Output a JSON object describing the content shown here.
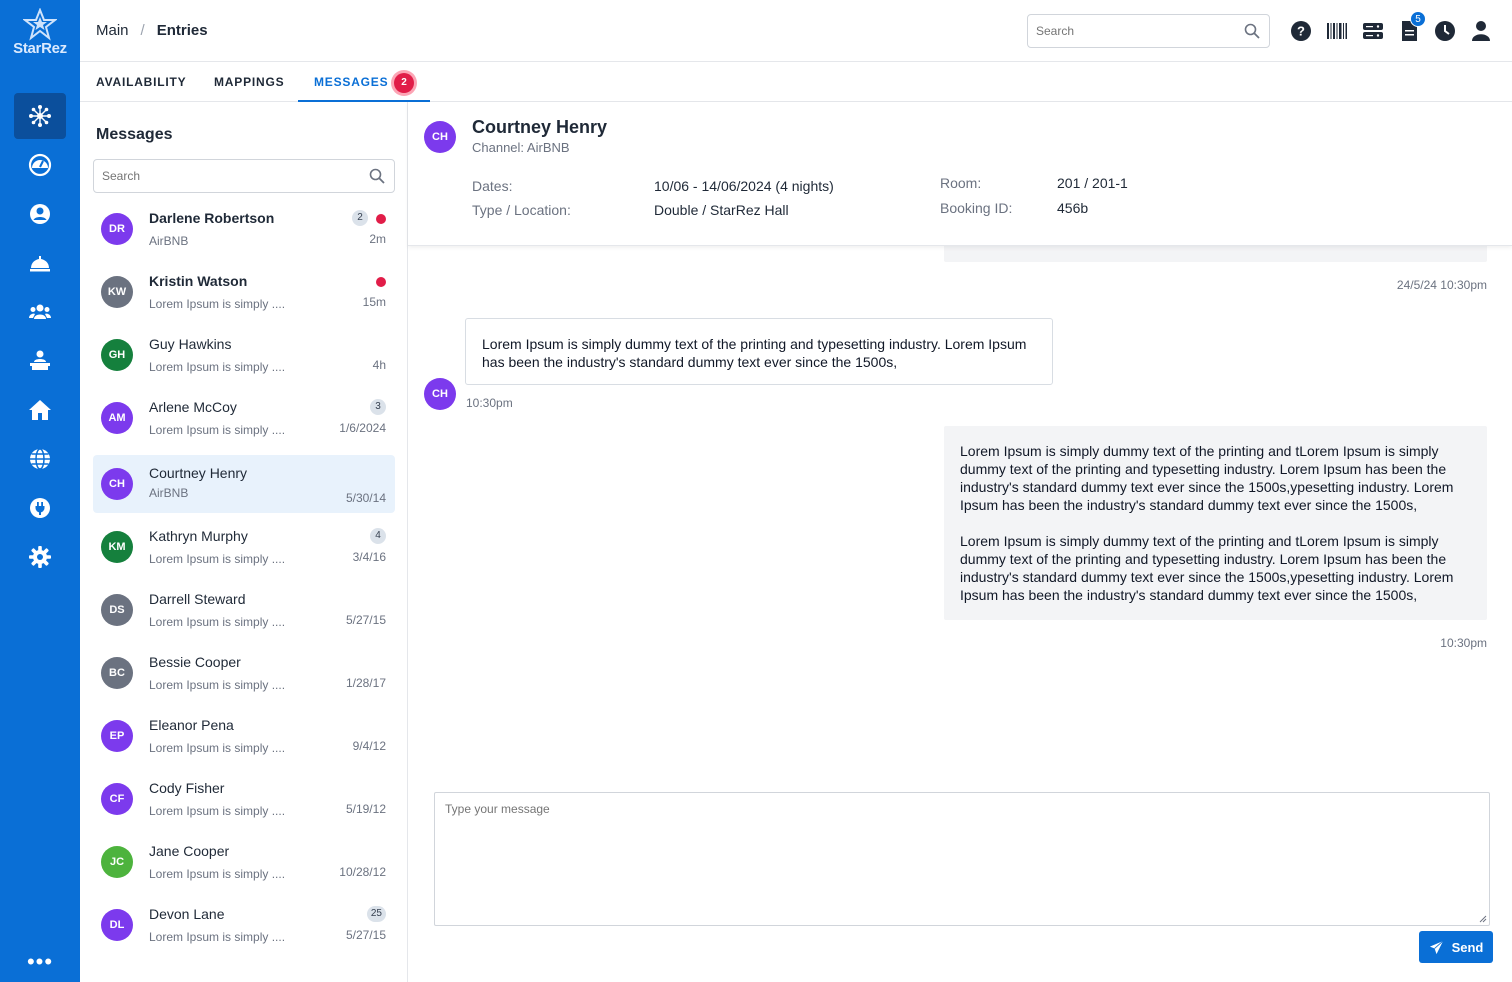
{
  "brand": {
    "logo_text": "StarRez"
  },
  "breadcrumb": {
    "root": "Main",
    "separator": "/",
    "current": "Entries"
  },
  "top_search": {
    "placeholder": "Search"
  },
  "top_icons": {
    "notifications_count": "5"
  },
  "tabs": [
    {
      "label": "AVAILABILITY"
    },
    {
      "label": "MAPPINGS"
    },
    {
      "label": "MESSAGES",
      "badge": "2"
    }
  ],
  "messages_panel": {
    "title": "Messages",
    "search_placeholder": "Search",
    "conversations": [
      {
        "initials": "DR",
        "name": "Darlene Robertson",
        "subtitle": "AirBNB",
        "time": "2m",
        "count": "2",
        "unread_dot": true,
        "bold": true,
        "avatar_color": "#7c3aed"
      },
      {
        "initials": "KW",
        "name": "Kristin Watson",
        "subtitle": "Lorem Ipsum is simply ....",
        "time": "15m",
        "count": "",
        "unread_dot": true,
        "bold": true,
        "avatar_color": "#6b7280"
      },
      {
        "initials": "GH",
        "name": "Guy Hawkins",
        "subtitle": "Lorem Ipsum is simply ....",
        "time": "4h",
        "count": "",
        "unread_dot": false,
        "bold": false,
        "avatar_color": "#15803d"
      },
      {
        "initials": "AM",
        "name": "Arlene McCoy",
        "subtitle": "Lorem Ipsum is simply ....",
        "time": "1/6/2024",
        "count": "3",
        "unread_dot": false,
        "bold": false,
        "avatar_color": "#7c3aed"
      },
      {
        "initials": "CH",
        "name": "Courtney Henry",
        "subtitle": "AirBNB",
        "time": "5/30/14",
        "count": "",
        "unread_dot": false,
        "bold": false,
        "avatar_color": "#7c3aed",
        "active": true
      },
      {
        "initials": "KM",
        "name": "Kathryn Murphy",
        "subtitle": "Lorem Ipsum is simply ....",
        "time": "3/4/16",
        "count": "4",
        "unread_dot": false,
        "bold": false,
        "avatar_color": "#15803d"
      },
      {
        "initials": "DS",
        "name": "Darrell Steward",
        "subtitle": "Lorem Ipsum is simply ....",
        "time": "5/27/15",
        "count": "",
        "unread_dot": false,
        "bold": false,
        "avatar_color": "#6b7280"
      },
      {
        "initials": "BC",
        "name": "Bessie Cooper",
        "subtitle": "Lorem Ipsum is simply ....",
        "time": "1/28/17",
        "count": "",
        "unread_dot": false,
        "bold": false,
        "avatar_color": "#6b7280"
      },
      {
        "initials": "EP",
        "name": "Eleanor Pena",
        "subtitle": "Lorem Ipsum is simply ....",
        "time": "9/4/12",
        "count": "",
        "unread_dot": false,
        "bold": false,
        "avatar_color": "#7c3aed"
      },
      {
        "initials": "CF",
        "name": "Cody Fisher",
        "subtitle": "Lorem Ipsum is simply ....",
        "time": "5/19/12",
        "count": "",
        "unread_dot": false,
        "bold": false,
        "avatar_color": "#7c3aed"
      },
      {
        "initials": "JC",
        "name": "Jane Cooper",
        "subtitle": "Lorem Ipsum is simply ....",
        "time": "10/28/12",
        "count": "",
        "unread_dot": false,
        "bold": false,
        "avatar_color": "#4db33d"
      },
      {
        "initials": "DL",
        "name": "Devon Lane",
        "subtitle": "Lorem Ipsum is simply ....",
        "time": "5/27/15",
        "count": "25",
        "unread_dot": false,
        "bold": false,
        "avatar_color": "#7c3aed"
      }
    ]
  },
  "chat_header": {
    "initials": "CH",
    "name": "Courtney Henry",
    "channel": "Channel: AirBNB",
    "dates_label": "Dates:",
    "dates_value": "10/06 - 14/06/2024 (4 nights)",
    "type_label": "Type / Location:",
    "type_value": "Double / StarRez Hall",
    "room_label": "Room:",
    "room_value": "201 / 201-1",
    "booking_label": "Booking ID:",
    "booking_value": "456b"
  },
  "chat": {
    "prev_timestamp": "24/5/24 10:30pm",
    "incoming": {
      "initials": "CH",
      "text": "Lorem Ipsum is simply dummy text of the printing and typesetting industry. Lorem Ipsum has been the industry's standard dummy text ever since the 1500s,",
      "time": "10:30pm"
    },
    "outgoing": {
      "paragraph1": "Lorem Ipsum is simply dummy text of the printing and tLorem Ipsum is simply dummy text of the printing and typesetting industry. Lorem Ipsum has been the industry's standard dummy text ever since the 1500s,ypesetting industry. Lorem Ipsum has been the industry's standard dummy text ever since the 1500s,",
      "paragraph2": "Lorem Ipsum is simply dummy text of the printing and tLorem Ipsum is simply dummy text of the printing and typesetting industry. Lorem Ipsum has been the industry's standard dummy text ever since the 1500s,ypesetting industry. Lorem Ipsum has been the industry's standard dummy text ever since the 1500s,",
      "time": "10:30pm"
    }
  },
  "composer": {
    "placeholder": "Type your message",
    "send_label": "Send"
  },
  "rail_more": "•••",
  "colors": {
    "brand_blue": "#0a6fd6",
    "rail_active": "#0b4f9c",
    "alert_red": "#e11d48"
  }
}
